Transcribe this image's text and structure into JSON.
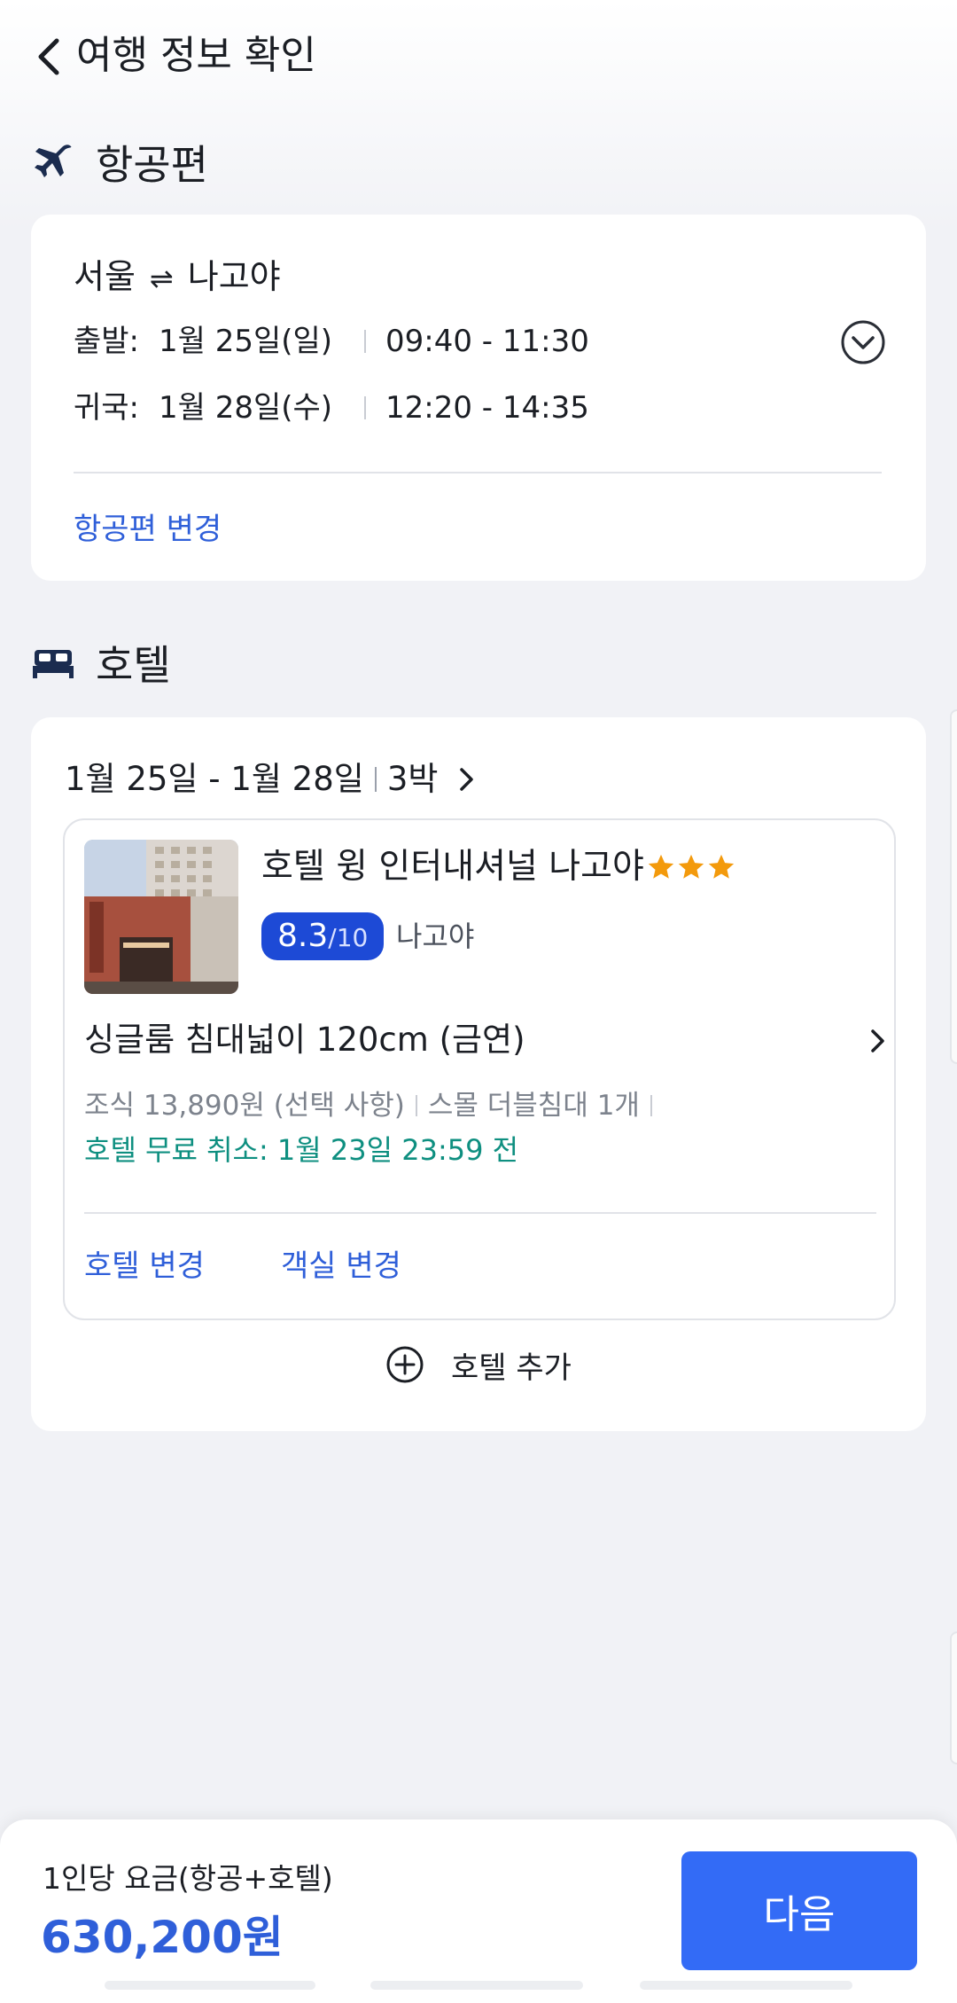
{
  "header": {
    "title": "여행 정보 확인"
  },
  "flight_section": {
    "title": "항공편",
    "route_from": "서울",
    "route_arrows": "⇌",
    "route_to": "나고야",
    "departure": {
      "label": "출발:",
      "date": "1월 25일(일)",
      "time": "09:40 - 11:30"
    },
    "return": {
      "label": "귀국:",
      "date": "1월 28일(수)",
      "time": "12:20 - 14:35"
    },
    "change_link": "항공편 변경"
  },
  "hotel_section": {
    "title": "호텔",
    "dates": "1월 25일 - 1월 28일",
    "nights": "3박",
    "hotel_name": "호텔 윙 인터내셔널 나고야",
    "star_rating": 3,
    "rating_score": "8.3",
    "rating_scale": "/10",
    "city": "나고야",
    "room_name": "싱글룸 침대넓이 120cm (금연)",
    "breakfast": "조식 13,890원 (선택 사항)",
    "bed": "스몰 더블침대 1개",
    "cancellation": "호텔 무료 취소: 1월 23일 23:59 전",
    "change_hotel": "호텔 변경",
    "change_room": "객실 변경",
    "add_hotel": "호텔 추가"
  },
  "bottom": {
    "price_label": "1인당 요금(항공+호텔)",
    "price": "630,200원",
    "next_button": "다음"
  },
  "colors": {
    "accent": "#336bf6",
    "link": "#2f5fd9",
    "cancel": "#0e8f80",
    "rating_badge": "#1d4ad6",
    "star": "#f39a0c"
  }
}
